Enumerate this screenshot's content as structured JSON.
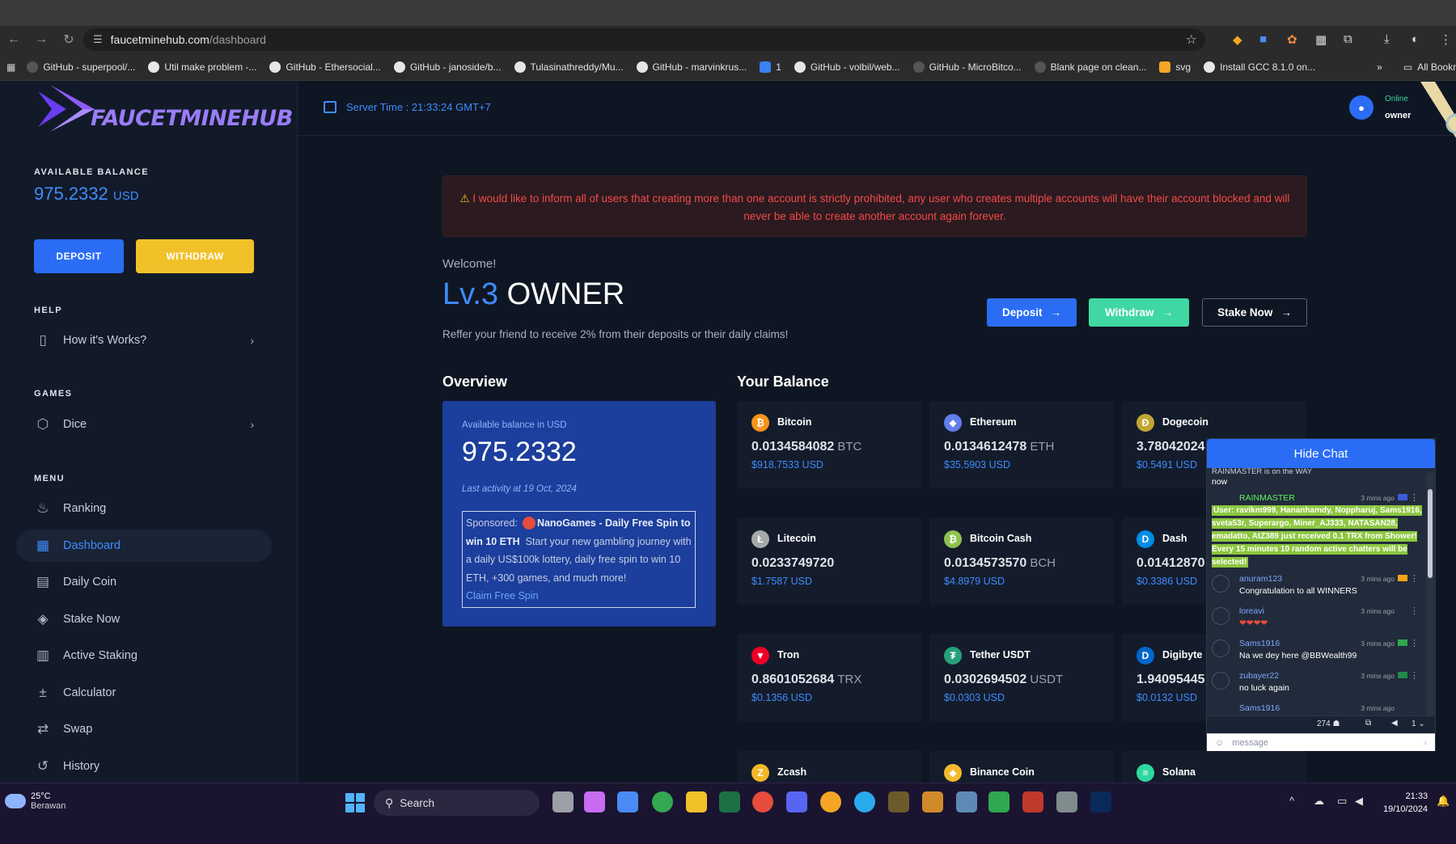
{
  "browser": {
    "url_host": "faucetminehub.com",
    "url_path": "/dashboard",
    "bookmarks": [
      "GitHub - superpool/...",
      "Util make problem -...",
      "GitHub - Ethersocial...",
      "GitHub - janoside/b...",
      "Tulasinathreddy/Mu...",
      "GitHub - marvinkrus...",
      "1",
      "GitHub - volbil/web...",
      "GitHub - MicroBitco...",
      "Blank page on clean...",
      "svg",
      "Install GCC 8.1.0 on..."
    ],
    "more_bookmarks": "»",
    "all_bookmarks": "All Bookmarks"
  },
  "logo": {
    "text": "FAUCETMINEHUB"
  },
  "sidebar": {
    "balance_label": "AVAILABLE BALANCE",
    "balance_value": "975.2332",
    "balance_unit": "USD",
    "deposit_label": "DEPOSIT",
    "withdraw_label": "WITHDRAW",
    "help_label": "HELP",
    "help_item": "How it's Works?",
    "games_label": "GAMES",
    "games_item": "Dice",
    "menu_label": "MENU",
    "menu": [
      {
        "label": "Ranking",
        "icon": "flame-icon"
      },
      {
        "label": "Dashboard",
        "icon": "grid-icon"
      },
      {
        "label": "Daily Coin",
        "icon": "coin-icon"
      },
      {
        "label": "Stake Now",
        "icon": "layers-icon"
      },
      {
        "label": "Active Staking",
        "icon": "stack-icon"
      },
      {
        "label": "Calculator",
        "icon": "calculator-icon"
      },
      {
        "label": "Swap",
        "icon": "swap-icon"
      },
      {
        "label": "History",
        "icon": "history-icon"
      }
    ]
  },
  "header": {
    "server_time": "Server Time : 21:33:24 GMT+7",
    "status": "Online",
    "username": "owner"
  },
  "alert": {
    "text": "I would like to inform all of users that creating more than one account is strictly prohibited, any user who creates multiple accounts will have their account blocked and will never be able to create another account again forever."
  },
  "welcome": {
    "greeting": "Welcome!",
    "level": "Lv.3",
    "name": "OWNER",
    "referral": "Reffer your friend to receive 2% from their deposits or their daily claims!"
  },
  "actions": {
    "deposit": "Deposit",
    "withdraw": "Withdraw",
    "stake": "Stake Now"
  },
  "overview": {
    "title": "Overview",
    "label": "Available balance in USD",
    "amount": "975.2332",
    "last_activity": "Last activity at 19 Oct, 2024",
    "sponsored_label": "Sponsored:",
    "sponsored_title": "NanoGames - Daily Free Spin to win 10 ETH",
    "sponsored_text": "Start your new gambling journey with a daily US$100k lottery, daily free spin to win 10 ETH, +300 games, and much more!",
    "claim": "Claim Free Spin"
  },
  "balance": {
    "title": "Your Balance",
    "coins": [
      {
        "name": "Bitcoin",
        "amount": "0.0134584082",
        "symbol": "BTC",
        "usd": "$918.7533 USD",
        "color": "#f7931a",
        "glyph": "₿"
      },
      {
        "name": "Ethereum",
        "amount": "0.0134612478",
        "symbol": "ETH",
        "usd": "$35.5903 USD",
        "color": "#627eea",
        "glyph": "◆"
      },
      {
        "name": "Dogecoin",
        "amount": "3.78042024",
        "symbol": "",
        "usd": "$0.5491 USD",
        "color": "#c2a633",
        "glyph": "Ð"
      },
      {
        "name": "Litecoin",
        "amount": "0.0233749720",
        "symbol": "",
        "usd": "$1.7587 USD",
        "color": "#a6a9aa",
        "glyph": "Ł"
      },
      {
        "name": "Bitcoin Cash",
        "amount": "0.0134573570",
        "symbol": "BCH",
        "usd": "$4.8979 USD",
        "color": "#8dc351",
        "glyph": "₿"
      },
      {
        "name": "Dash",
        "amount": "0.01412870",
        "symbol": "",
        "usd": "$0.3386 USD",
        "color": "#008ce7",
        "glyph": "D"
      },
      {
        "name": "Tron",
        "amount": "0.8601052684",
        "symbol": "TRX",
        "usd": "$0.1356 USD",
        "color": "#ef0027",
        "glyph": "▼"
      },
      {
        "name": "Tether USDT",
        "amount": "0.0302694502",
        "symbol": "USDT",
        "usd": "$0.0303 USD",
        "color": "#26a17b",
        "glyph": "₮"
      },
      {
        "name": "Digibyte",
        "amount": "1.94095445",
        "symbol": "",
        "usd": "$0.0132 USD",
        "color": "#0066cc",
        "glyph": "D"
      },
      {
        "name": "Zcash",
        "amount": "",
        "symbol": "",
        "usd": "",
        "color": "#f4b728",
        "glyph": "Z"
      },
      {
        "name": "Binance Coin",
        "amount": "",
        "symbol": "",
        "usd": "",
        "color": "#f3ba2f",
        "glyph": "◆"
      },
      {
        "name": "Solana",
        "amount": "",
        "symbol": "",
        "usd": "",
        "color": "#2fd8a0",
        "glyph": "≡"
      }
    ]
  },
  "chat": {
    "hide_label": "Hide Chat",
    "partial_top": "RAINMASTER is on the WAY",
    "now": "now",
    "messages": [
      {
        "user": "RAINMASTER",
        "time": "3 mins ago",
        "text": "User: ravikm999, Hananhamdy, Noppharuj, Sams1916, sveta53r, Superargo, Miner_AJ333, NATASAN28, emadatto, AtZ389 just received 0.1 TRX from Shower! Every 15 minutes 10 random active chatters will be selected!"
      },
      {
        "user": "anuram123",
        "time": "3 mins ago",
        "text": "Congratulation to all WINNERS"
      },
      {
        "user": "loreavi",
        "time": "3 mins ago",
        "text": "❤❤❤❤"
      },
      {
        "user": "Sams1916",
        "time": "3 mins ago",
        "text": "Na we dey here @BBWealth99"
      },
      {
        "user": "zubayer22",
        "time": "3 mins ago",
        "text": "no luck again"
      },
      {
        "user": "Sams1916",
        "time": "3 mins ago",
        "text": ""
      }
    ],
    "online_count": "274",
    "page": "1",
    "input_placeholder": "message"
  },
  "taskbar": {
    "temp": "25°C",
    "weather": "Berawan",
    "search": "Search",
    "time": "21:33",
    "date": "19/10/2024"
  }
}
